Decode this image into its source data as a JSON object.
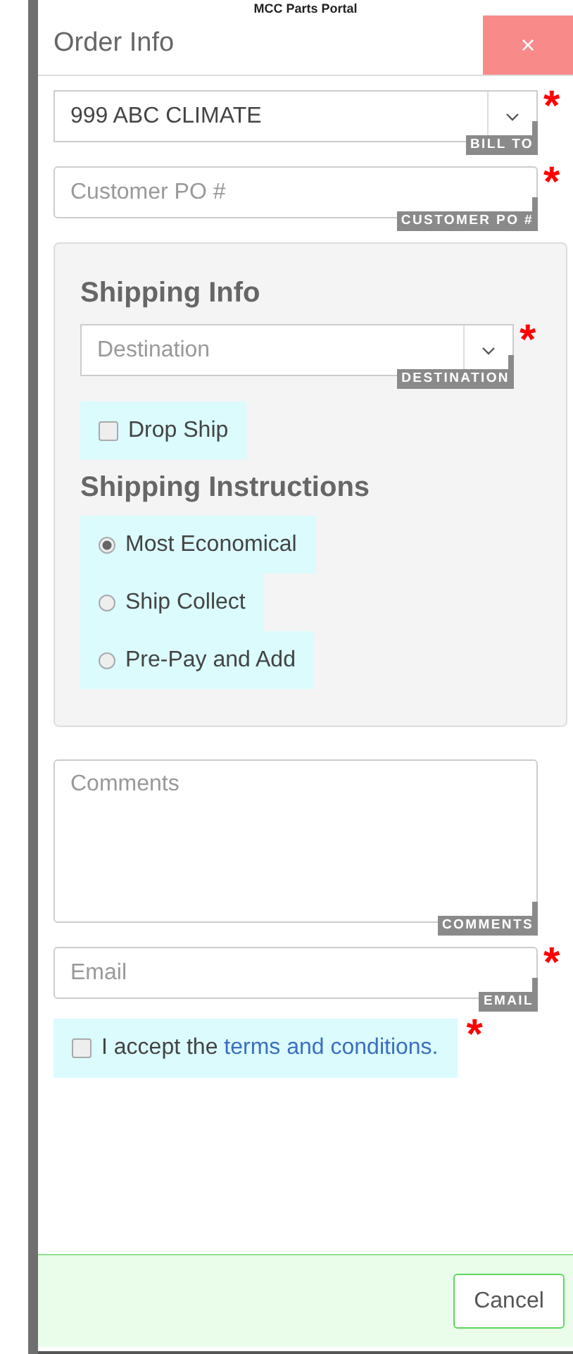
{
  "page_title": "MCC Parts Portal",
  "modal": {
    "title": "Order Info",
    "close": "×"
  },
  "top_fields": [
    {
      "kind": "select",
      "value": "999 ABC CLIMATE",
      "tag": "BILL TO",
      "required_mark": "*"
    },
    {
      "kind": "input",
      "placeholder": "Customer PO #",
      "tag": "CUSTOMER PO #",
      "required_mark": "*"
    }
  ],
  "shipping": {
    "heading": "Shipping Info",
    "destination": {
      "kind": "select",
      "placeholder": "Destination",
      "tag": "DESTINATION",
      "required_mark": "*"
    },
    "drop_ship": {
      "label": "Drop Ship",
      "checked": false
    },
    "instructions_heading": "Shipping Instructions",
    "options": [
      {
        "label": "Most Economical",
        "selected": true
      },
      {
        "label": "Ship Collect",
        "selected": false
      },
      {
        "label": "Pre-Pay and Add",
        "selected": false
      }
    ]
  },
  "bottom_fields": [
    {
      "kind": "textarea",
      "placeholder": "Comments",
      "tag": "COMMENTS"
    },
    {
      "kind": "input",
      "placeholder": "Email",
      "tag": "EMAIL",
      "required_mark": "*"
    }
  ],
  "terms": {
    "text": "I accept the ",
    "link": "terms and conditions.",
    "checked": false,
    "required_mark": "*"
  },
  "footer": {
    "cancel": "Cancel"
  }
}
